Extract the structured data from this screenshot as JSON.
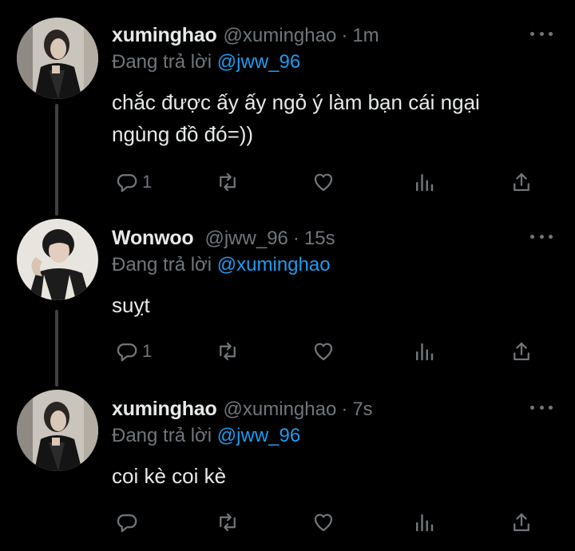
{
  "thread": {
    "reply_prefix": "Đang trả lời"
  },
  "colors": {
    "background": "#000000",
    "text": "#e7e9ea",
    "secondary": "#71767b",
    "accent": "#1d9bf0",
    "thread_line": "#3e4144"
  },
  "tweets": [
    {
      "name": "xuminghao",
      "handle": "@xuminghao",
      "separator": "·",
      "time": "1m",
      "reply_to": "@jww_96",
      "lines": [
        "chắc được ấy ấy ngỏ ý làm bạn cái ngại",
        "ngùng đồ đó=))"
      ],
      "reply_count": "1",
      "avatar_icon": "avatar-xuminghao"
    },
    {
      "name": "Wonwoo",
      "handle": "@jww_96",
      "separator": "·",
      "time": "15s",
      "reply_to": "@xuminghao",
      "lines": [
        "suỵt"
      ],
      "reply_count": "1",
      "avatar_icon": "avatar-wonwoo"
    },
    {
      "name": "xuminghao",
      "handle": "@xuminghao",
      "separator": "·",
      "time": "7s",
      "reply_to": "@jww_96",
      "lines": [
        "coi kè coi kè"
      ],
      "reply_count": "",
      "avatar_icon": "avatar-xuminghao"
    }
  ]
}
